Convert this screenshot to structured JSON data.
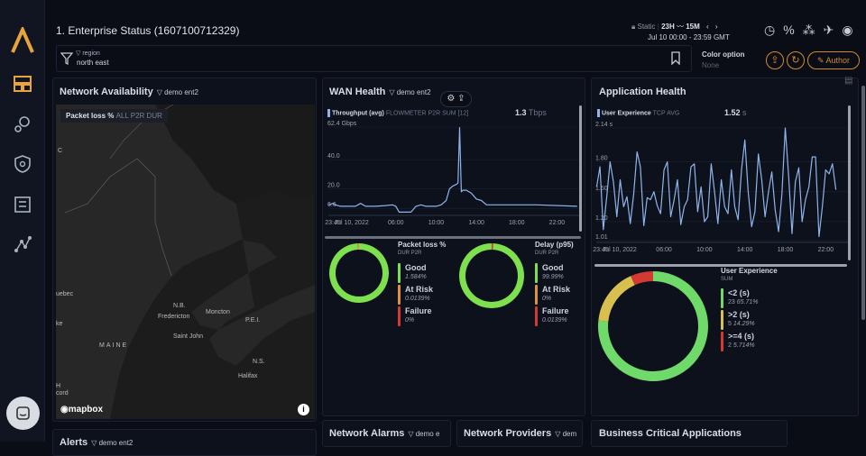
{
  "header": {
    "title": "1. Enterprise Status (1607100712329)",
    "filter_label": "region",
    "filter_value": "north east",
    "lock_label": "Static",
    "range": "23H",
    "interval": "15M",
    "time_window": "Jul 10 00:00 - 23:59 GMT",
    "color_option_label": "Color option",
    "color_option_value": "None",
    "author_button": "Author",
    "accent_color": "#d08a2c"
  },
  "sidebar": {
    "items": [
      "logo",
      "dashboards",
      "search-analytics",
      "security",
      "reports",
      "topology"
    ]
  },
  "network_availability": {
    "title": "Network Availability",
    "filter": "demo ent2",
    "metric": "Packet loss %",
    "metric_sub": "ALL P2R DUR",
    "map_labels": [
      "C",
      "uebec",
      "N.B.",
      "Fredericton",
      "Moncton",
      "P.E.I.",
      "MAINE",
      "Saint John",
      "N.S.",
      "Halifax",
      "ke",
      "H",
      "cord"
    ],
    "attribution": "mapbox"
  },
  "wan_health": {
    "title": "WAN Health",
    "filter": "demo ent2",
    "metric": "Throughput (avg)",
    "metric_sub": "FLOWMETER P2R SUM [12]",
    "current_value": "1.3",
    "current_unit": "Tbps",
    "packet_loss": {
      "title": "Packet loss %",
      "sub": "DUR P2R",
      "items": [
        {
          "label": "Good",
          "value": "1.584%",
          "amount": 1.584,
          "color": "#7ee04e"
        },
        {
          "label": "At Risk",
          "value": "0.0139%",
          "amount": 0.0139,
          "color": "#e0913f"
        },
        {
          "label": "Failure",
          "value": "0%",
          "amount": 0,
          "color": "#d23a32"
        }
      ]
    },
    "delay": {
      "title": "Delay (p95)",
      "sub": "DUR P2R",
      "items": [
        {
          "label": "Good",
          "value": "99.99%",
          "amount": 99.99,
          "color": "#7ee04e"
        },
        {
          "label": "At Risk",
          "value": "0%",
          "amount": 0,
          "color": "#e0913f"
        },
        {
          "label": "Failure",
          "value": "0.0139%",
          "amount": 0.0139,
          "color": "#d23a32"
        }
      ]
    }
  },
  "application_health": {
    "title": "Application Health",
    "metric": "User Experience",
    "metric_sub": "TCP  AVG",
    "current_value": "1.52",
    "current_unit": "s",
    "ux": {
      "title": "User Experience",
      "sub": "SUM",
      "items": [
        {
          "label": "<2 (s)",
          "count": 23,
          "pct": "65.71%",
          "color": "#6fd96a"
        },
        {
          "label": ">2 (s)",
          "count": 5,
          "pct": "14.29%",
          "color": "#d8c050"
        },
        {
          "label": ">=4 (s)",
          "count": 2,
          "pct": "5.714%",
          "color": "#d23a32"
        }
      ]
    }
  },
  "bottom": {
    "alerts": "Alerts",
    "alerts_filter": "demo ent2",
    "network_alarms": "Network Alarms",
    "network_alarms_filter": "demo e",
    "network_providers": "Network Providers",
    "network_providers_filter": "dem",
    "business_apps": "Business Critical Applications"
  },
  "chart_data": [
    {
      "type": "line",
      "title": "Throughput (avg)",
      "ylabel": "Gbps",
      "y_ticks": [
        "62.4 Gbps",
        "40.0",
        "20.0",
        "6.6"
      ],
      "y_tick_values": [
        62.4,
        40,
        20,
        6.6
      ],
      "x_ticks": [
        "23:45",
        "Jul 10, 2022",
        "06:00",
        "10:00",
        "14:00",
        "18:00",
        "22:00"
      ],
      "ylim": [
        3,
        62.4
      ],
      "color": "#8fb4ec",
      "x": [
        "23:20",
        "23:45",
        "00:00",
        "00:30",
        "01:00",
        "02:00",
        "02:30",
        "03:00",
        "04:00",
        "05:00",
        "05:40",
        "06:00",
        "06:20",
        "06:40",
        "07:30",
        "08:00",
        "08:30",
        "09:00",
        "10:00",
        "10:30",
        "11:00",
        "11:20",
        "11:40",
        "12:00",
        "12:10",
        "12:20",
        "12:30",
        "12:40",
        "13:00",
        "13:30",
        "14:00",
        "14:30",
        "15:00",
        "15:30",
        "16:00",
        "20:00",
        "24:00"
      ],
      "values": [
        9,
        10,
        9,
        8,
        8,
        8,
        10,
        8,
        8,
        8.5,
        9,
        8,
        4,
        4,
        4,
        8,
        9,
        8,
        8,
        9,
        12,
        20,
        22,
        23,
        24,
        62,
        18,
        19,
        19,
        17,
        13,
        12,
        9,
        9,
        9,
        9,
        8
      ]
    },
    {
      "type": "line",
      "title": "User Experience",
      "ylabel": "s",
      "y_ticks": [
        "2.14 s",
        "1.80",
        "1.50",
        "1.20",
        "1.01"
      ],
      "y_tick_values": [
        2.14,
        1.8,
        1.5,
        1.2,
        1.01
      ],
      "x_ticks": [
        "23:45",
        "Jul 10, 2022",
        "06:00",
        "10:00",
        "14:00",
        "18:00",
        "22:00"
      ],
      "ylim": [
        1.01,
        2.14
      ],
      "color": "#8fb4ec",
      "x": [
        "23:20",
        "23:40",
        "00:00",
        "00:20",
        "00:40",
        "01:00",
        "01:20",
        "01:40",
        "02:00",
        "02:20",
        "02:40",
        "03:00",
        "03:20",
        "03:40",
        "04:00",
        "04:20",
        "04:40",
        "05:00",
        "05:20",
        "05:40",
        "06:00",
        "06:20",
        "06:40",
        "07:00",
        "07:20",
        "07:40",
        "08:00",
        "08:20",
        "08:40",
        "09:00",
        "09:20",
        "09:40",
        "10:00",
        "10:20",
        "10:40",
        "11:00",
        "11:20",
        "11:40",
        "12:00",
        "12:20",
        "12:40",
        "13:00",
        "13:20",
        "13:40",
        "14:00",
        "14:20",
        "14:40",
        "15:00",
        "15:20",
        "15:40",
        "16:00",
        "16:20",
        "16:40",
        "17:00",
        "17:20",
        "17:40",
        "18:00",
        "18:20",
        "18:40",
        "19:00",
        "19:20",
        "19:40",
        "20:00",
        "20:20",
        "20:40",
        "21:00",
        "21:20",
        "21:40",
        "22:00",
        "22:20",
        "22:40",
        "23:00"
      ],
      "values": [
        1.55,
        1.75,
        1.12,
        1.45,
        1.8,
        1.6,
        1.25,
        1.62,
        1.35,
        1.45,
        1.18,
        1.48,
        1.9,
        1.75,
        1.16,
        1.44,
        1.42,
        1.5,
        1.36,
        1.28,
        1.72,
        1.8,
        1.25,
        1.42,
        1.62,
        1.17,
        1.35,
        1.42,
        1.75,
        1.78,
        1.3,
        1.55,
        1.2,
        1.25,
        1.78,
        1.5,
        1.18,
        1.62,
        1.35,
        1.28,
        1.72,
        1.35,
        1.22,
        1.72,
        2.02,
        1.5,
        1.15,
        1.3,
        1.88,
        1.62,
        1.25,
        1.5,
        1.7,
        1.32,
        1.1,
        1.48,
        2.14,
        1.65,
        1.08,
        1.6,
        1.74,
        1.2,
        1.42,
        1.55,
        1.85,
        1.85,
        1.05,
        1.35,
        1.72,
        1.68,
        1.78,
        1.52
      ]
    },
    {
      "type": "pie",
      "title": "Packet loss %",
      "categories": [
        "Good",
        "At Risk",
        "Failure"
      ],
      "values": [
        1.584,
        0.0139,
        0
      ]
    },
    {
      "type": "pie",
      "title": "Delay (p95)",
      "categories": [
        "Good",
        "At Risk",
        "Failure"
      ],
      "values": [
        99.99,
        0,
        0.0139
      ]
    },
    {
      "type": "pie",
      "title": "User Experience",
      "categories": [
        "<2 (s)",
        ">2 (s)",
        ">=4 (s)"
      ],
      "values": [
        23,
        5,
        2
      ]
    }
  ]
}
